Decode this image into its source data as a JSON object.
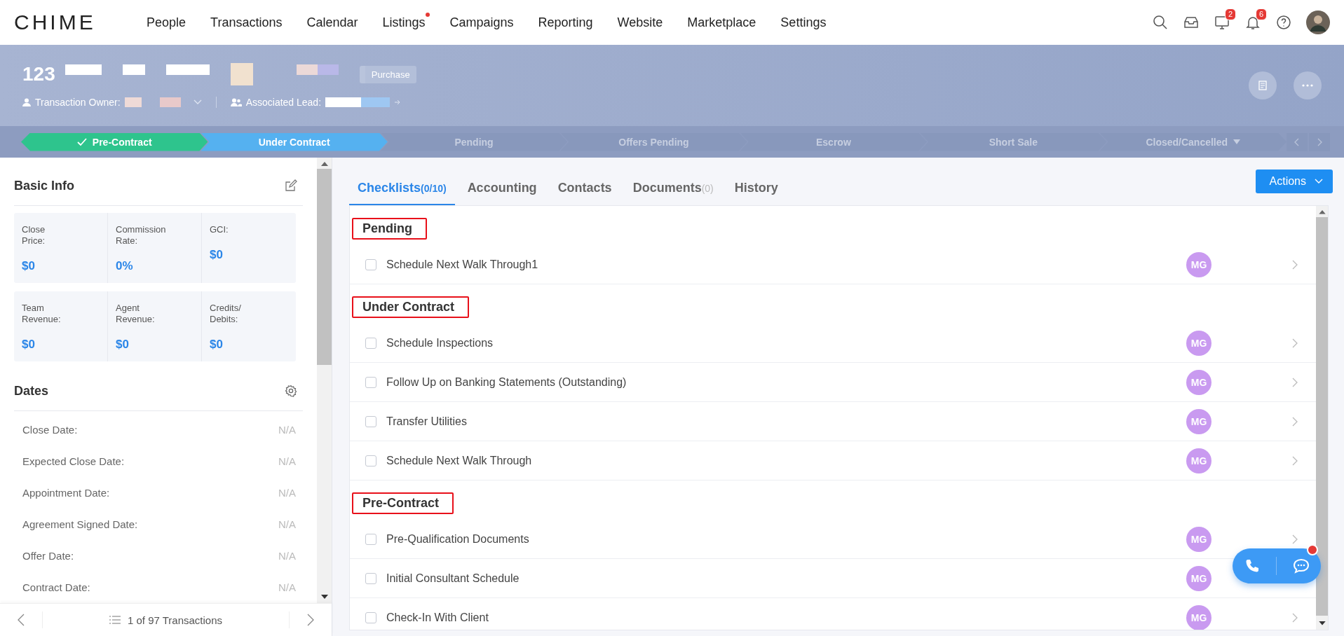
{
  "nav": {
    "logo": "CHIME",
    "items": [
      {
        "label": "People",
        "dot": false
      },
      {
        "label": "Transactions",
        "dot": false
      },
      {
        "label": "Calendar",
        "dot": false
      },
      {
        "label": "Listings",
        "dot": true
      },
      {
        "label": "Campaigns",
        "dot": false
      },
      {
        "label": "Reporting",
        "dot": false
      },
      {
        "label": "Website",
        "dot": false
      },
      {
        "label": "Marketplace",
        "dot": false
      },
      {
        "label": "Settings",
        "dot": false
      }
    ],
    "icons": [
      {
        "kind": "search"
      },
      {
        "kind": "inbox"
      },
      {
        "kind": "monitor",
        "badge": "2"
      },
      {
        "kind": "bell",
        "badge": "6"
      },
      {
        "kind": "help"
      },
      {
        "kind": "avatar"
      }
    ]
  },
  "header": {
    "title": "123",
    "tag": "Purchase",
    "owner_label": "Transaction Owner:",
    "lead_label": "Associated Lead:"
  },
  "stages": [
    {
      "label": "Pre-Contract",
      "completed": true,
      "selected": false
    },
    {
      "label": "Under Contract",
      "completed": false,
      "selected": true
    },
    {
      "label": "Pending",
      "completed": false,
      "selected": false
    },
    {
      "label": "Offers Pending",
      "completed": false,
      "selected": false
    },
    {
      "label": "Escrow",
      "completed": false,
      "selected": false
    },
    {
      "label": "Short Sale",
      "completed": false,
      "selected": false
    },
    {
      "label": "Closed/Cancelled",
      "completed": false,
      "selected": false,
      "dropdown": true
    }
  ],
  "basic_info": {
    "title": "Basic Info",
    "rows": [
      [
        {
          "label": "Close Price:",
          "value": "$0"
        },
        {
          "label": "Commission Rate:",
          "value": "0%"
        },
        {
          "label": "GCI:",
          "value": "$0"
        }
      ],
      [
        {
          "label": "Team Revenue:",
          "value": "$0"
        },
        {
          "label": "Agent Revenue:",
          "value": "$0"
        },
        {
          "label": "Credits/ Debits:",
          "value": "$0"
        }
      ]
    ]
  },
  "dates": {
    "title": "Dates",
    "rows": [
      {
        "label": "Close Date:",
        "value": "N/A"
      },
      {
        "label": "Expected Close Date:",
        "value": "N/A"
      },
      {
        "label": "Appointment Date:",
        "value": "N/A"
      },
      {
        "label": "Agreement Signed Date:",
        "value": "N/A"
      },
      {
        "label": "Offer Date:",
        "value": "N/A"
      },
      {
        "label": "Contract Date:",
        "value": "N/A"
      }
    ]
  },
  "pager": {
    "text": "1 of 97 Transactions"
  },
  "tabs": [
    {
      "label": "Checklists",
      "count": "(0/10)",
      "selected": true
    },
    {
      "label": "Accounting",
      "selected": false
    },
    {
      "label": "Contacts",
      "selected": false
    },
    {
      "label": "Documents",
      "count": "(0)",
      "selected": false
    },
    {
      "label": "History",
      "selected": false
    }
  ],
  "actions_button": "Actions",
  "checklist": [
    {
      "title": "Pending",
      "highlighted": true,
      "items": [
        {
          "label": "Schedule Next Walk Through1",
          "checked": false,
          "assignee": "MG"
        }
      ]
    },
    {
      "title": "Under Contract",
      "highlighted": true,
      "items": [
        {
          "label": "Schedule Inspections",
          "checked": false,
          "assignee": "MG"
        },
        {
          "label": "Follow Up on Banking Statements (Outstanding)",
          "checked": false,
          "assignee": "MG"
        },
        {
          "label": "Transfer Utilities",
          "checked": false,
          "assignee": "MG"
        },
        {
          "label": "Schedule Next Walk Through",
          "checked": false,
          "assignee": "MG"
        }
      ]
    },
    {
      "title": "Pre-Contract",
      "highlighted": true,
      "items": [
        {
          "label": "Pre-Qualification Documents",
          "checked": false,
          "assignee": "MG"
        },
        {
          "label": "Initial Consultant Schedule",
          "checked": false,
          "assignee": "MG"
        },
        {
          "label": "Check-In With Client",
          "checked": false,
          "assignee": "MG"
        }
      ]
    }
  ]
}
